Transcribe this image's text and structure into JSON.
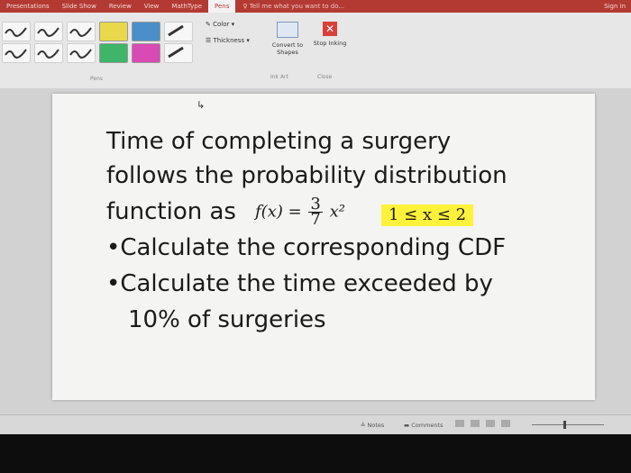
{
  "ribbon_tabs": [
    {
      "label": "Presentations"
    },
    {
      "label": "Slide Show"
    },
    {
      "label": "Review"
    },
    {
      "label": "View"
    },
    {
      "label": "MathType"
    },
    {
      "label": "Pens"
    }
  ],
  "tell_me": "Tell me what you want to do...",
  "sign_in": "Sign in",
  "ribbon": {
    "pens_group_label": "Pens",
    "color_label": "Color",
    "thickness_label": "Thickness",
    "convert_label": "Convert to Shapes",
    "stop_label": "Stop Inking",
    "ink_art_label": "Ink Art",
    "close_label": "Close",
    "pens": [
      {
        "color": "#333333"
      },
      {
        "color": "#333333"
      },
      {
        "color": "#333333"
      },
      {
        "color": "#e8d84a"
      },
      {
        "color": "#4a8fc9"
      },
      {
        "color": "#333333"
      },
      {
        "color": "#333333"
      },
      {
        "color": "#333333"
      },
      {
        "color": "#333333"
      },
      {
        "color": "#3fb56a"
      },
      {
        "color": "#d84ab4"
      },
      {
        "color": "#333333"
      }
    ]
  },
  "slide": {
    "line1": "Time of completing a surgery",
    "line2": "follows the probability distribution",
    "line3": "function as",
    "formula": {
      "lhs": "f(x) =",
      "num": "3",
      "den": "7",
      "rhs": "x²"
    },
    "domain": "1 ≤ x ≤ 2",
    "bullet1": "Calculate the corresponding CDF",
    "bullet2": "Calculate the time exceeded by",
    "bullet2_cont": "10% of surgeries"
  },
  "status": {
    "notes_label": "Notes",
    "comments_label": "Comments"
  },
  "colors": {
    "accent": "#b33a33",
    "highlight": "#fff23a"
  }
}
